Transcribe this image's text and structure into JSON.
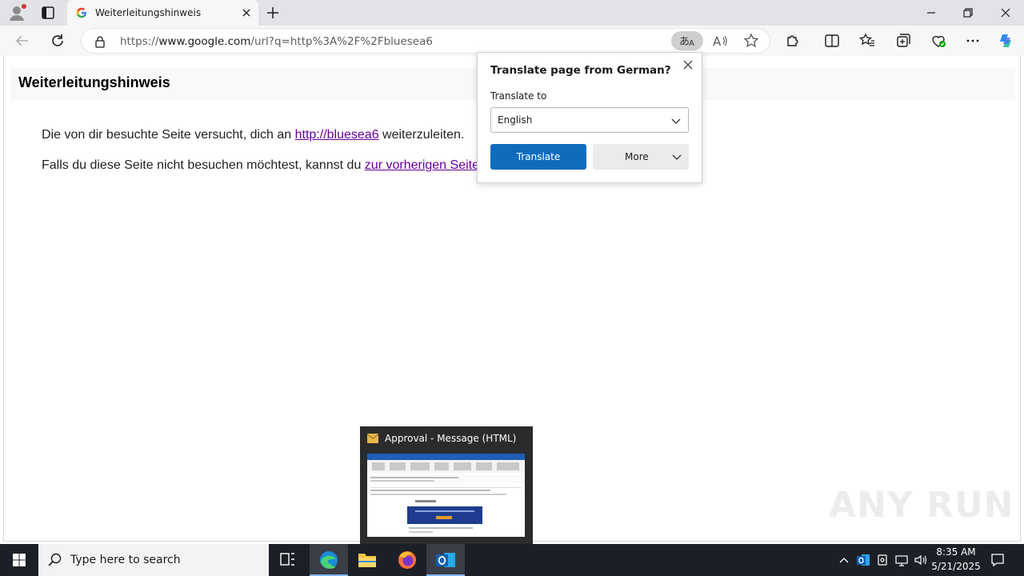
{
  "browser": {
    "tab_title": "Weiterleitungshinweis",
    "url_prefix": "https://",
    "url_host": "www.google.com",
    "url_path": "/url?q=http%3A%2F%2Fbluesea6"
  },
  "page": {
    "heading": "Weiterleitungshinweis",
    "line1_before": "Die von dir besuchte Seite versucht, dich an ",
    "line1_link": "http://bluesea6",
    "line1_after": " weiterzuleiten.",
    "line2_before": "Falls du diese Seite nicht besuchen möchtest, kannst du ",
    "line2_link": "zur vorherigen Seite zu"
  },
  "translate_popup": {
    "title": "Translate page from German?",
    "label": "Translate to",
    "selected_language": "English",
    "translate_button": "Translate",
    "more_button": "More"
  },
  "thumbnail": {
    "title": "Approval - Message (HTML)"
  },
  "watermark": "ANY RUN",
  "taskbar": {
    "search_placeholder": "Type here to search",
    "time": "8:35 AM",
    "date": "5/21/2025"
  },
  "colors": {
    "accent": "#0f6cbd",
    "link_visited": "#660099",
    "taskbar": "#1c1f26"
  }
}
